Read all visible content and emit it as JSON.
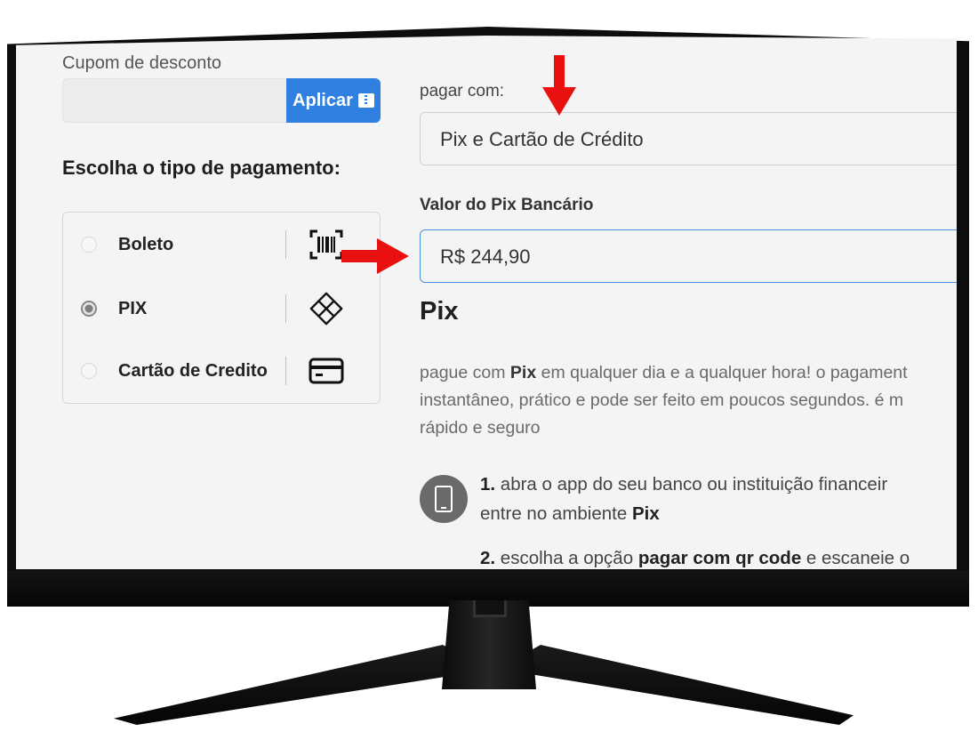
{
  "coupon": {
    "label": "Cupom de desconto",
    "value": "",
    "button_label": "Aplicar"
  },
  "payment_type": {
    "title": "Escolha o tipo de pagamento:",
    "options": [
      {
        "label": "Boleto",
        "icon": "barcode-icon",
        "selected": false
      },
      {
        "label": "PIX",
        "icon": "pix-icon",
        "selected": true
      },
      {
        "label": "Cartão de Credito",
        "icon": "credit-card-icon",
        "selected": false
      }
    ]
  },
  "pay_with": {
    "label": "pagar com:",
    "value": "Pix e Cartão de Crédito"
  },
  "pix_amount": {
    "label": "Valor do Pix Bancário",
    "value": "R$ 244,90"
  },
  "pix_section": {
    "title": "Pix",
    "desc_line1_a": "pague com ",
    "desc_line1_b": "Pix",
    "desc_line1_c": " em qualquer dia e a qualquer hora! o pagament",
    "desc_line2": "instantâneo, prático e pode ser feito em poucos segundos. é m",
    "desc_line3": "rápido e seguro",
    "step1_num": "1.",
    "step1_text": " abra o app do seu banco ou instituição financeir",
    "step1_line2_a": "entre no ambiente ",
    "step1_line2_b": "Pix",
    "step2_num": "2.",
    "step2_a": " escolha a opção ",
    "step2_b": "pagar com qr code",
    "step2_c": " e escaneie o"
  },
  "colors": {
    "primary": "#2f80e0",
    "arrow": "#e8110f",
    "input_focus": "#4a8fd9"
  }
}
